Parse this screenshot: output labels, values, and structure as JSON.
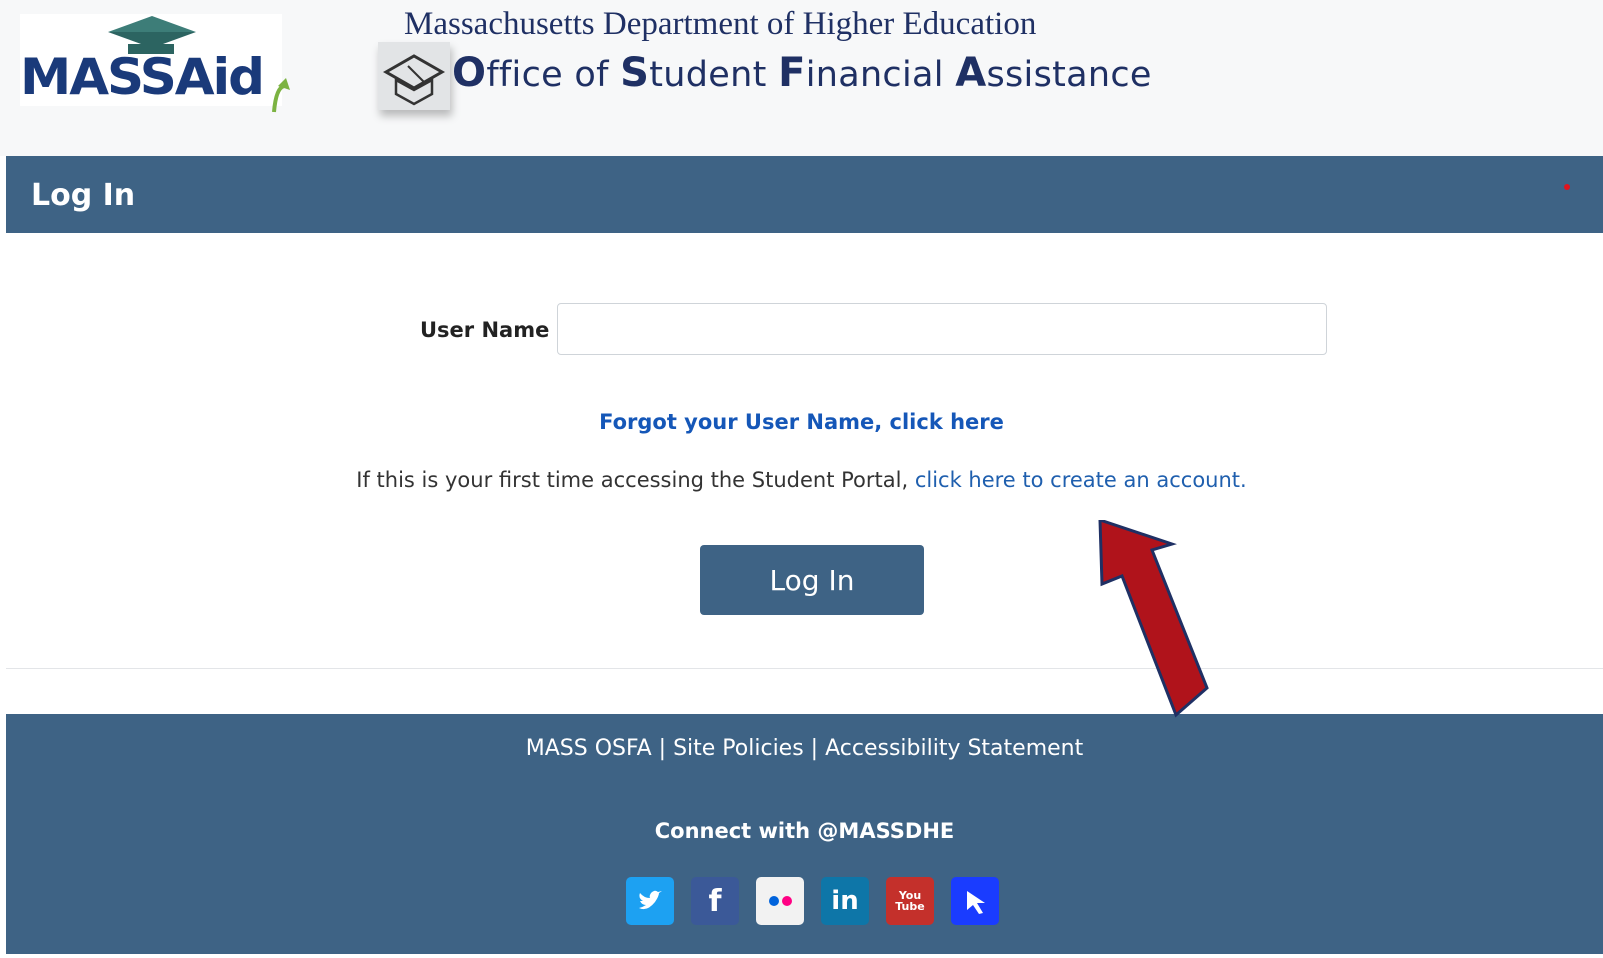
{
  "header": {
    "logo_text": "MASSAid",
    "department": "Massachusetts Department of Higher Education",
    "office_initials": [
      "O",
      "S",
      "F",
      "A"
    ],
    "office_rest": [
      "ffice of ",
      "tudent ",
      "inancial ",
      "ssistance"
    ]
  },
  "topbar": {
    "title": "Log In"
  },
  "form": {
    "username_label": "User Name",
    "username_value": "",
    "forgot_link": "Forgot your User Name, click here",
    "first_time_text": "If this is your first time accessing the Student Portal, ",
    "create_account_link": "click here to create an account.",
    "login_button": "Log In"
  },
  "footer": {
    "links": [
      "MASS OSFA",
      "Site Policies",
      "Accessibility Statement"
    ],
    "separator": " | ",
    "connect": "Connect with @MASSDHE",
    "social": [
      {
        "name": "twitter-icon",
        "color": "#1da1f2"
      },
      {
        "name": "facebook-icon",
        "color": "#3b5998",
        "glyph": "f"
      },
      {
        "name": "flickr-icon",
        "color": "#f2f2f2"
      },
      {
        "name": "linkedin-icon",
        "color": "#0e76a8",
        "glyph": "in"
      },
      {
        "name": "youtube-icon",
        "color": "#c4302b",
        "glyph": "You Tube"
      },
      {
        "name": "pinned-icon",
        "color": "#1a3cff"
      }
    ]
  },
  "colors": {
    "brand_blue": "#3e6385",
    "link_blue": "#1557b8",
    "annotation_red": "#b0131b"
  }
}
